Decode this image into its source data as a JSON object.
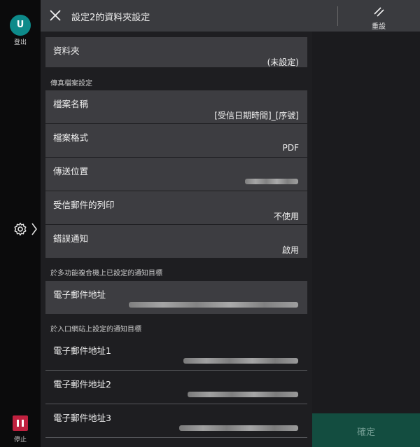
{
  "sidebar": {
    "avatar_initial": "U",
    "logout_label": "登出",
    "stop_label": "停止"
  },
  "header": {
    "title": "設定2的資料夾設定",
    "reset_label": "重設"
  },
  "folder": {
    "label": "資料夾",
    "value": "(未設定)"
  },
  "fax_section": {
    "heading": "傳真檔案設定",
    "rows": [
      {
        "label": "檔案名稱",
        "value": "[受信日期時間]_[序號]"
      },
      {
        "label": "檔案格式",
        "value": "PDF"
      },
      {
        "label": "傳送位置",
        "value": ""
      },
      {
        "label": "受信郵件的列印",
        "value": "不使用"
      },
      {
        "label": "錯誤通知",
        "value": "啟用"
      }
    ]
  },
  "device_section": {
    "heading": "於多功能複合機上已設定的通知目標",
    "rows": [
      {
        "label": "電子郵件地址"
      }
    ]
  },
  "portal_section": {
    "heading": "於入口網站上設定的通知目標",
    "rows": [
      {
        "label": "電子郵件地址1"
      },
      {
        "label": "電子郵件地址2"
      },
      {
        "label": "電子郵件地址3"
      }
    ]
  },
  "footer": {
    "confirm_label": "確定"
  },
  "colors": {
    "accent_teal": "#0d8a8a",
    "stop_red": "#c0213f",
    "confirm_disabled": "#134d40"
  }
}
